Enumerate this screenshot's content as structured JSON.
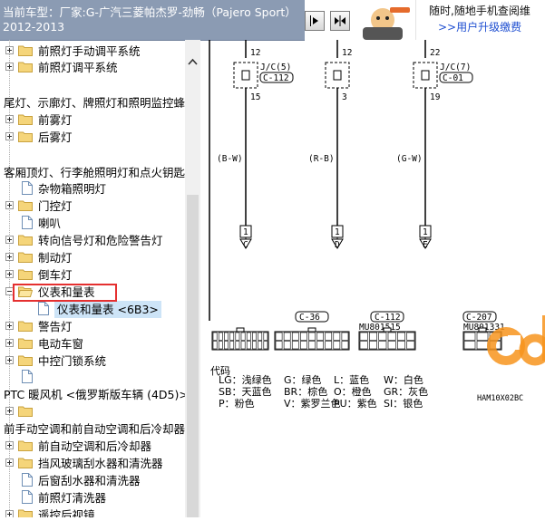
{
  "header": {
    "car_label": "当前车型：厂家:G-广汽三菱帕杰罗-劲畅（Pajero Sport）2012-2013",
    "promo_line1": "随时,随地手机查阅维",
    "promo_line2": ">>用户升级缴费"
  },
  "tree": {
    "items": [
      {
        "label": "前照灯手动调平系统",
        "kind": "folder",
        "expand": "plus"
      },
      {
        "label": "前照灯调平系统",
        "kind": "folder",
        "expand": "plus"
      },
      {
        "label": "尾灯、示廓灯、牌照灯和照明监控蜂",
        "kind": "folder",
        "expand": "plus"
      },
      {
        "label": "前雾灯",
        "kind": "folder",
        "expand": "plus"
      },
      {
        "label": "后雾灯",
        "kind": "folder",
        "expand": "plus"
      },
      {
        "label": "客厢顶灯、行李舱照明灯和点火钥匙",
        "kind": "folder",
        "expand": "plus"
      },
      {
        "label": "杂物箱照明灯",
        "kind": "doc"
      },
      {
        "label": "门控灯",
        "kind": "folder",
        "expand": "plus"
      },
      {
        "label": "喇叭",
        "kind": "doc"
      },
      {
        "label": "转向信号灯和危险警告灯",
        "kind": "folder",
        "expand": "plus"
      },
      {
        "label": "制动灯",
        "kind": "folder",
        "expand": "plus"
      },
      {
        "label": "倒车灯",
        "kind": "folder",
        "expand": "plus"
      },
      {
        "label": "仪表和量表",
        "kind": "folder-open",
        "expand": "minus"
      },
      {
        "label": "仪表和量表 <6B3>",
        "kind": "doc-child"
      },
      {
        "label": "警告灯",
        "kind": "folder",
        "expand": "plus"
      },
      {
        "label": "电动车窗",
        "kind": "folder",
        "expand": "plus"
      },
      {
        "label": "中控门锁系统",
        "kind": "folder",
        "expand": "plus"
      },
      {
        "label": "",
        "kind": "doc"
      },
      {
        "label": "PTC 暖风机 <俄罗斯版车辆 (4D5)>",
        "kind": "doc"
      },
      {
        "label": "",
        "kind": "folder",
        "expand": "plus"
      },
      {
        "label": "前手动空调和前自动空调和后冷却器",
        "kind": "folder",
        "expand": "plus"
      },
      {
        "label": "前自动空调和后冷却器",
        "kind": "folder",
        "expand": "plus"
      },
      {
        "label": "挡风玻璃刮水器和清洗器",
        "kind": "folder",
        "expand": "plus"
      },
      {
        "label": "后窗刮水器和清洗器",
        "kind": "doc"
      },
      {
        "label": "前照灯清洗器",
        "kind": "doc"
      },
      {
        "label": "遥控后视镜",
        "kind": "folder",
        "expand": "plus"
      }
    ]
  },
  "diagram": {
    "wires": [
      {
        "top_pin": "12",
        "junction": "J/C(5)",
        "connector": "C-112",
        "bottom_pin": "15",
        "color_code": "(B-W)",
        "terminal": "1",
        "ref": "C"
      },
      {
        "top_pin": "12",
        "junction": "",
        "connector": "",
        "bottom_pin": "3",
        "color_code": "(R-B)",
        "terminal": "1",
        "ref": "D"
      },
      {
        "top_pin": "22",
        "junction": "J/C(7)",
        "connector": "C-01",
        "bottom_pin": "19",
        "color_code": "(G-W)",
        "terminal": "1",
        "ref": "E"
      }
    ],
    "connectors": [
      {
        "name": "",
        "code": ""
      },
      {
        "name": "C-36",
        "code": ""
      },
      {
        "name": "C-112",
        "code": "MU801515"
      },
      {
        "name": "C-207",
        "code": "MU801331"
      }
    ],
    "legend_title": "代码",
    "legend": [
      [
        "LG：浅绿色",
        "G：绿色",
        "L：蓝色",
        "W：白色"
      ],
      [
        "SB：天蓝色",
        "BR：棕色",
        "O：橙色",
        "GR：灰色"
      ],
      [
        "P：粉色",
        "V：紫罗兰色",
        "PU：紫色",
        "SI：银色"
      ]
    ],
    "figure_code": "HAM10X02BC"
  },
  "colors": {
    "header_bg": "#8b9bb3",
    "selection": "#cde4f7",
    "highlight": "#e53030",
    "watermark": "#f7941d"
  }
}
